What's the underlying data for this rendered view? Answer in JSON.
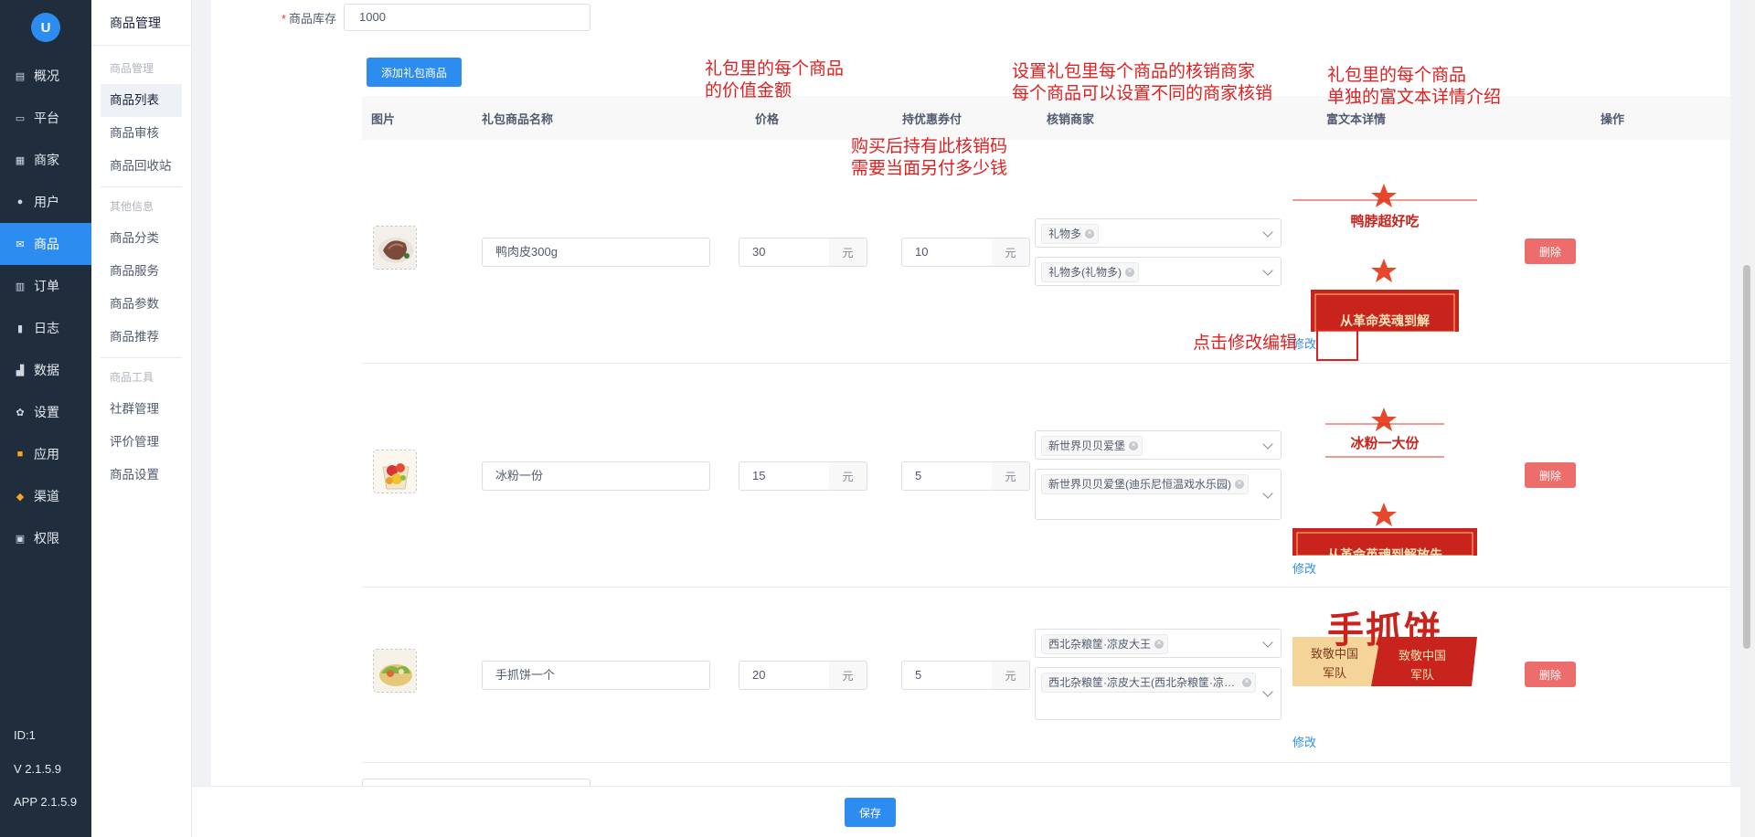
{
  "sidebar": {
    "logo": "U",
    "items": [
      {
        "label": "概况",
        "icon": "chart-icon"
      },
      {
        "label": "平台",
        "icon": "monitor-icon"
      },
      {
        "label": "商家",
        "icon": "store-icon"
      },
      {
        "label": "用户",
        "icon": "user-icon"
      },
      {
        "label": "商品",
        "icon": "goods-icon"
      },
      {
        "label": "订单",
        "icon": "order-icon"
      },
      {
        "label": "日志",
        "icon": "log-icon"
      },
      {
        "label": "数据",
        "icon": "data-icon"
      },
      {
        "label": "设置",
        "icon": "gear-icon"
      },
      {
        "label": "应用",
        "icon": "apps-icon"
      },
      {
        "label": "渠道",
        "icon": "cube-icon"
      },
      {
        "label": "权限",
        "icon": "lock-icon"
      }
    ],
    "active_index": 4,
    "footer": {
      "id": "ID:1",
      "version": "V 2.1.5.9",
      "app": "APP 2.1.5.9"
    }
  },
  "submenu": {
    "title": "商品管理",
    "groups": [
      {
        "label": "商品管理",
        "items": [
          "商品列表",
          "商品审核",
          "商品回收站"
        ]
      },
      {
        "label": "其他信息",
        "items": [
          "商品分类",
          "商品服务",
          "商品参数",
          "商品推荐"
        ]
      },
      {
        "label": "商品工具",
        "items": [
          "社群管理",
          "评价管理",
          "商品设置"
        ]
      }
    ],
    "active": "商品列表"
  },
  "form": {
    "stock_label": "商品库存",
    "stock_value": "1000",
    "add_button": "添加礼包商品"
  },
  "table": {
    "headers": [
      "图片",
      "礼包商品名称",
      "价格",
      "持优惠券付",
      "核销商家",
      "富文本详情",
      "操作"
    ],
    "rows": [
      {
        "name": "鸭肉皮300g",
        "price": "30",
        "coupon": "10",
        "unit": "元",
        "merchant": "礼物多",
        "store": "礼物多(礼物多)",
        "rich_title": "鸭脖超好吃",
        "rich_banner": "从革命英魂到解",
        "edit": "修改",
        "delete": "删除"
      },
      {
        "name": "冰粉一份",
        "price": "15",
        "coupon": "5",
        "unit": "元",
        "merchant": "新世界贝贝爱堡",
        "store": "新世界贝贝爱堡(迪乐尼恒温戏水乐园)",
        "rich_title": "冰粉一大份",
        "rich_banner": "从革命英魂到解放先",
        "edit": "修改",
        "delete": "删除"
      },
      {
        "name": "手抓饼一个",
        "price": "20",
        "coupon": "5",
        "unit": "元",
        "merchant": "西北杂粮筐·凉皮大王",
        "store": "西北杂粮筐·凉皮大王(西北杂粮筐·凉皮大王)",
        "rich_title": "手抓饼",
        "rich_sub1": "致敬中国军队",
        "rich_sub2": "致敬中国军队",
        "edit": "修改",
        "delete": "删除"
      }
    ]
  },
  "annotations": {
    "price_note": [
      "礼包里的每个商品",
      "的价值金额"
    ],
    "coupon_note": [
      "购买后持有此核销码",
      "需要当面另付多少钱"
    ],
    "merchant_note": [
      "设置礼包里每个商品的核销商家",
      "每个商品可以设置不同的商家核销"
    ],
    "rich_note": [
      "礼包里的每个商品",
      "单独的富文本详情介绍"
    ],
    "edit_note": "点击修改编辑"
  },
  "footer": {
    "save_button": "保存"
  },
  "colors": {
    "primary": "#2d8cf0",
    "danger": "#ed6c6c",
    "annotation": "#e02020",
    "sidebar": "#1f2d3d"
  }
}
